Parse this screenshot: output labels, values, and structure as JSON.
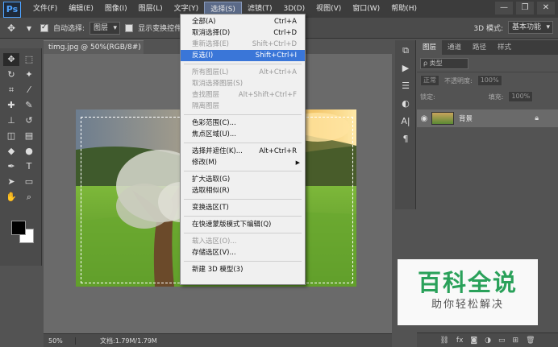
{
  "app": {
    "logo": "Ps"
  },
  "menubar": {
    "items": [
      "文件(F)",
      "编辑(E)",
      "图像(I)",
      "图层(L)",
      "文字(Y)",
      "选择(S)",
      "滤镜(T)",
      "3D(D)",
      "视图(V)",
      "窗口(W)",
      "帮助(H)"
    ],
    "active": "选择(S)"
  },
  "window_controls": {
    "minimize": "—",
    "restore": "❐",
    "close": "✕"
  },
  "options_bar": {
    "auto_select_label": "自动选择:",
    "auto_select_checked": true,
    "auto_select_target": "图层",
    "show_transform_label": "显示变换控件",
    "show_transform_checked": false,
    "mode_3d_label": "3D 模式:",
    "workspace": "基本功能"
  },
  "document": {
    "tab_title": "timg.jpg @ 50%(RGB/8#)",
    "close_glyph": "×",
    "zoom": "50%",
    "doc_info": "文档:1.79M/1.79M"
  },
  "select_menu": {
    "items": [
      {
        "label": "全部(A)",
        "shortcut": "Ctrl+A",
        "disabled": false
      },
      {
        "label": "取消选择(D)",
        "shortcut": "Ctrl+D",
        "disabled": false
      },
      {
        "label": "重新选择(E)",
        "shortcut": "Shift+Ctrl+D",
        "disabled": true
      },
      {
        "label": "反选(I)",
        "shortcut": "Shift+Ctrl+I",
        "disabled": false,
        "highlighted": true
      },
      {
        "sep": true
      },
      {
        "label": "所有图层(L)",
        "shortcut": "Alt+Ctrl+A",
        "disabled": true
      },
      {
        "label": "取消选择图层(S)",
        "shortcut": "",
        "disabled": true
      },
      {
        "label": "查找图层",
        "shortcut": "Alt+Shift+Ctrl+F",
        "disabled": true
      },
      {
        "label": "隔离图层",
        "shortcut": "",
        "disabled": true
      },
      {
        "sep": true
      },
      {
        "label": "色彩范围(C)...",
        "shortcut": "",
        "disabled": false
      },
      {
        "label": "焦点区域(U)...",
        "shortcut": "",
        "disabled": false
      },
      {
        "sep": true
      },
      {
        "label": "选择并遮住(K)...",
        "shortcut": "Alt+Ctrl+R",
        "disabled": false
      },
      {
        "label": "修改(M)",
        "shortcut": "",
        "disabled": false,
        "submenu": true
      },
      {
        "sep": true
      },
      {
        "label": "扩大选取(G)",
        "shortcut": "",
        "disabled": false
      },
      {
        "label": "选取相似(R)",
        "shortcut": "",
        "disabled": false
      },
      {
        "sep": true
      },
      {
        "label": "变换选区(T)",
        "shortcut": "",
        "disabled": false
      },
      {
        "sep": true
      },
      {
        "label": "在快速蒙版模式下编辑(Q)",
        "shortcut": "",
        "disabled": false
      },
      {
        "sep": true
      },
      {
        "label": "载入选区(O)...",
        "shortcut": "",
        "disabled": true
      },
      {
        "label": "存储选区(V)...",
        "shortcut": "",
        "disabled": false
      },
      {
        "sep": true
      },
      {
        "label": "新建 3D 模型(3)",
        "shortcut": "",
        "disabled": false
      }
    ]
  },
  "layers_panel": {
    "tabs": [
      "图层",
      "通道",
      "路径",
      "样式"
    ],
    "active_tab": "图层",
    "kind_filter": "ρ 类型",
    "blend_mode": "正常",
    "opacity_label": "不透明度:",
    "opacity_value": "100%",
    "lock_label": "锁定:",
    "fill_label": "填充:",
    "fill_value": "100%",
    "layers": [
      {
        "name": "背景",
        "locked": true,
        "visible": true
      }
    ],
    "footer_icons": [
      "link-icon",
      "fx-icon",
      "mask-icon",
      "adjustment-icon",
      "group-icon",
      "new-layer-icon",
      "trash-icon"
    ]
  },
  "watermark": {
    "title": "百科全说",
    "subtitle": "助你轻松解决"
  },
  "colors": {
    "menu_highlight": "#3a76d8",
    "watermark_green": "#2aa15a"
  }
}
